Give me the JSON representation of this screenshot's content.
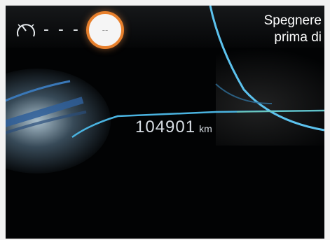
{
  "cluster": {
    "speed_limit_dashes": "- - -",
    "speed_limit_value": "--",
    "message_line1": "Spegnere",
    "message_line2": "prima di",
    "odometer_value": "104901",
    "odometer_unit": "km"
  },
  "colors": {
    "accent_cyan": "#4ab3e0",
    "badge_ring": "#e8802c",
    "text_white": "#ffffff"
  },
  "icons": {
    "gauge": "speedometer-icon"
  }
}
